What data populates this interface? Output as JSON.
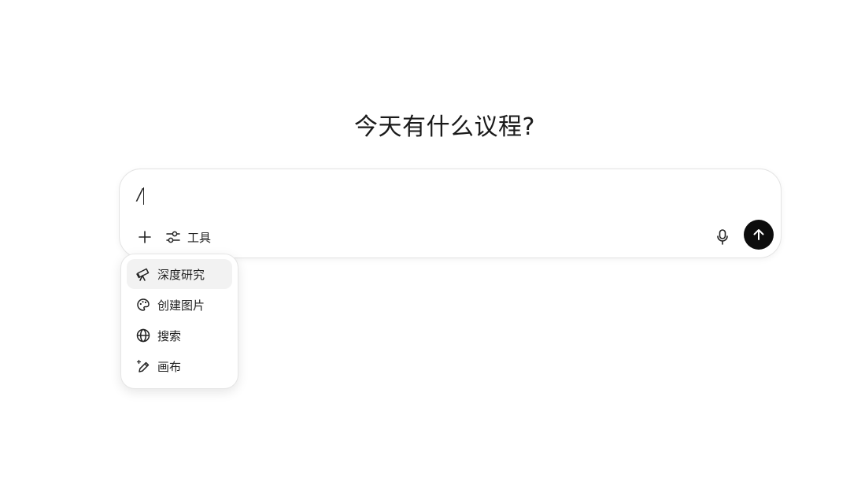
{
  "heading": "今天有什么议程?",
  "composer": {
    "input_value": "/",
    "tools_label": "工具"
  },
  "menu": {
    "items": [
      {
        "label": "深度研究",
        "icon": "telescope-icon",
        "active": true
      },
      {
        "label": "创建图片",
        "icon": "palette-icon",
        "active": false
      },
      {
        "label": "搜索",
        "icon": "globe-icon",
        "active": false
      },
      {
        "label": "画布",
        "icon": "pencil-sparkle-icon",
        "active": false
      }
    ]
  },
  "icons": {
    "plus": "plus-icon",
    "tools": "sliders-icon",
    "mic": "microphone-icon",
    "send": "arrow-up-icon"
  },
  "colors": {
    "send_button": "#0d0d0d",
    "menu_active_bg": "#f2f2f2",
    "border": "#e3e3e3"
  }
}
